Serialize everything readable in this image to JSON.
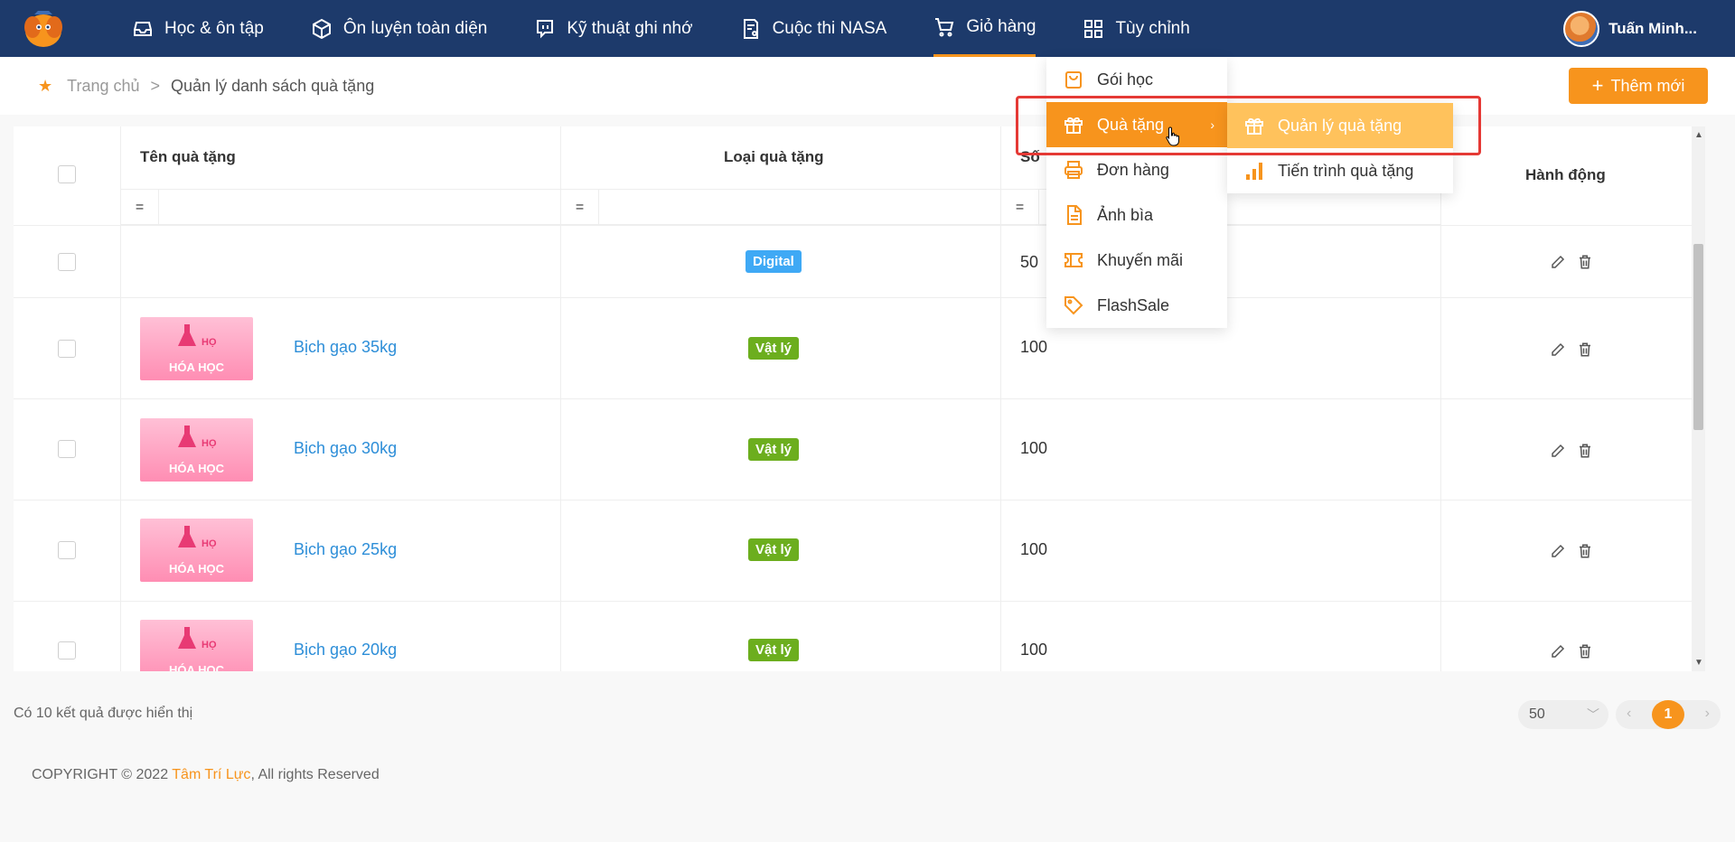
{
  "nav": {
    "items": [
      {
        "label": "Học & ôn tập",
        "icon": "inbox-icon"
      },
      {
        "label": "Ôn luyện toàn diện",
        "icon": "cube-icon"
      },
      {
        "label": "Kỹ thuật ghi nhớ",
        "icon": "chat-bubble-icon"
      },
      {
        "label": "Cuộc thi NASA",
        "icon": "document-icon"
      },
      {
        "label": "Giỏ hàng",
        "icon": "cart-icon"
      },
      {
        "label": "Tùy chỉnh",
        "icon": "grid-icon"
      }
    ],
    "user_name": "Tuấn Minh..."
  },
  "breadcrumb": {
    "home": "Trang chủ",
    "separator": ">",
    "current": "Quản lý danh sách quà tặng"
  },
  "toolbar": {
    "add_label": "Thêm mới",
    "add_symbol": "+"
  },
  "table": {
    "columns": {
      "name": "Tên quà tặng",
      "type": "Loại quà tặng",
      "qty": "Số",
      "actions": "Hành động"
    },
    "filter_symbol": "=",
    "rows": [
      {
        "name": "",
        "type": "Digital",
        "qty": "50",
        "has_image": false
      },
      {
        "name": "Bịch gạo 35kg",
        "type": "Vật lý",
        "qty": "100",
        "has_image": true
      },
      {
        "name": "Bịch gạo 30kg",
        "type": "Vật lý",
        "qty": "100",
        "has_image": true
      },
      {
        "name": "Bịch gạo 25kg",
        "type": "Vật lý",
        "qty": "100",
        "has_image": true
      },
      {
        "name": "Bịch gạo 20kg",
        "type": "Vật lý",
        "qty": "100",
        "has_image": true
      }
    ],
    "thumb_text_1": "HỌ",
    "thumb_text_2": "HÓA HỌC"
  },
  "footer": {
    "result_text": "Có 10 kết quả được hiển thị",
    "page_size": "50",
    "current_page": "1",
    "copyright_prefix": "COPYRIGHT © 2022 ",
    "copyright_brand": "Tâm Trí Lực",
    "copyright_suffix": ", All rights Reserved"
  },
  "dropdown": {
    "items": [
      {
        "label": "Gói học",
        "icon": "bag-icon"
      },
      {
        "label": "Quà tặng",
        "icon": "gift-icon"
      },
      {
        "label": "Đơn hàng",
        "icon": "printer-icon"
      },
      {
        "label": "Ảnh bìa",
        "icon": "file-icon"
      },
      {
        "label": "Khuyến mãi",
        "icon": "ticket-icon"
      },
      {
        "label": "FlashSale",
        "icon": "tag-icon"
      }
    ],
    "active_index": 1,
    "submenu": [
      {
        "label": "Quản lý quà tặng",
        "icon": "gift-icon"
      },
      {
        "label": "Tiến trình quà tặng",
        "icon": "bar-chart-icon"
      }
    ]
  },
  "colors": {
    "navbar": "#1d3a6b",
    "accent": "#f7941d",
    "highlight": "#e53935",
    "link": "#2d8ed8"
  }
}
